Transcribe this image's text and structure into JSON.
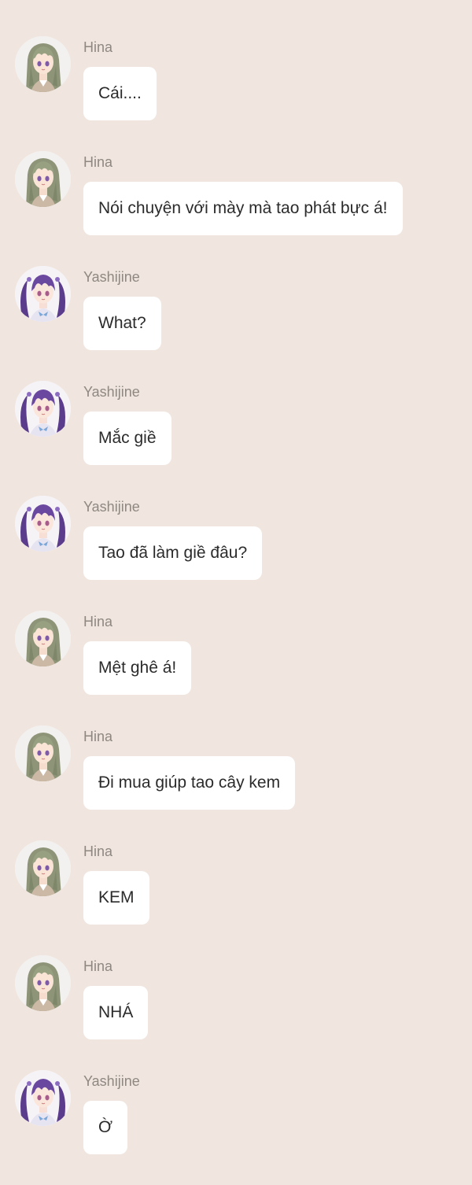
{
  "colors": {
    "background": "#f0e6df",
    "bubble": "#ffffff",
    "sender_text": "#8e8782",
    "message_text": "#2b2b2b"
  },
  "messages": [
    {
      "sender": "Hina",
      "text": "Cái....",
      "avatar": "hina-avatar"
    },
    {
      "sender": "Hina",
      "text": "Nói chuyện với mày mà tao phát bực á!",
      "avatar": "hina-avatar"
    },
    {
      "sender": "Yashijine",
      "text": "What?",
      "avatar": "yashijine-avatar"
    },
    {
      "sender": "Yashijine",
      "text": "Mắc giề",
      "avatar": "yashijine-avatar"
    },
    {
      "sender": "Yashijine",
      "text": "Tao đã làm giề đâu?",
      "avatar": "yashijine-avatar"
    },
    {
      "sender": "Hina",
      "text": "Mệt ghê á!",
      "avatar": "hina-avatar"
    },
    {
      "sender": "Hina",
      "text": "Đi mua giúp tao cây kem",
      "avatar": "hina-avatar"
    },
    {
      "sender": "Hina",
      "text": "KEM",
      "avatar": "hina-avatar"
    },
    {
      "sender": "Hina",
      "text": "NHÁ",
      "avatar": "hina-avatar"
    },
    {
      "sender": "Yashijine",
      "text": "Ờ",
      "avatar": "yashijine-avatar"
    }
  ]
}
